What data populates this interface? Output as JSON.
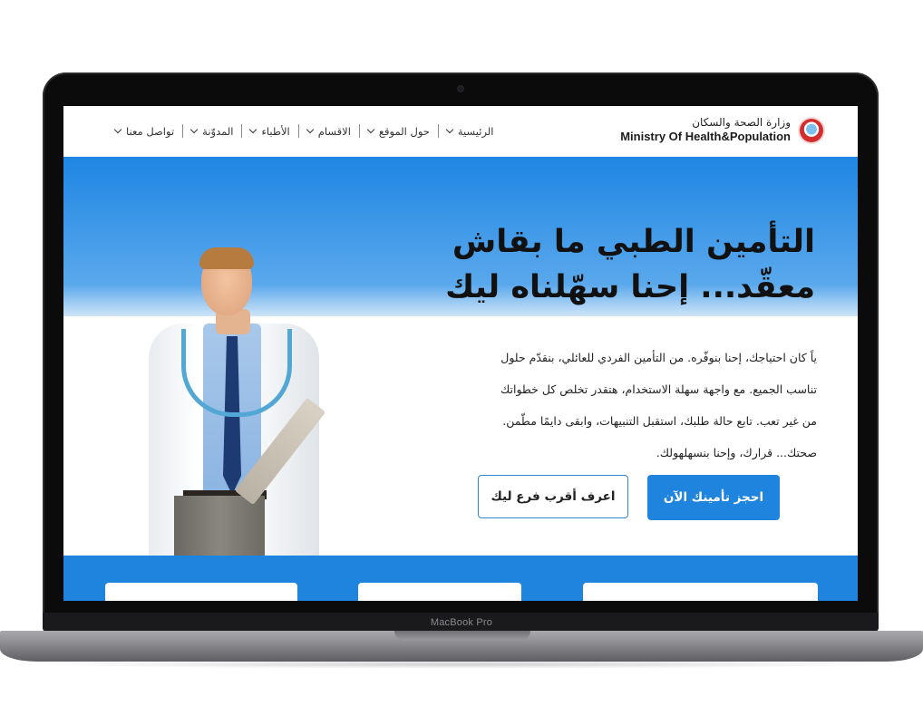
{
  "device": {
    "label": "MacBook Pro"
  },
  "header": {
    "brand_ar": "وزارة الصحة والسكان",
    "brand_en": "Ministry Of Health&Population",
    "logo_icon": "ministry-emblem"
  },
  "nav": {
    "items": [
      {
        "label": "الرئيسية"
      },
      {
        "label": "حول الموقع"
      },
      {
        "label": "الاقسام"
      },
      {
        "label": "الأطباء"
      },
      {
        "label": "المدوّنة"
      },
      {
        "label": "تواصل معنا"
      }
    ]
  },
  "hero": {
    "title_line1": "التأمين الطبي ما بقاش",
    "title_line2": "معقّد... إحنا سهّلناه ليك",
    "body_lines": [
      "ياً كان احتياجك، إحنا بنوفّره. من التأمين الفردي للعائلي، بنقدّم حلول",
      "تناسب الجميع. مع واجهة سهلة الاستخدام، هتقدر تخلص كل خطواتك",
      "من غير تعب. تابع حالة طلبك، استقبل التنبيهات، وابقى دايمًا مطّمن.",
      "صحتك... قرارك، وإحنا بنسهلهولك."
    ],
    "primary_button": "احجز تأمينك الآن",
    "secondary_button": "اعرف أقرب فرع ليك"
  },
  "colors": {
    "primary": "#1f84de",
    "text": "#111111",
    "background": "#ffffff"
  }
}
